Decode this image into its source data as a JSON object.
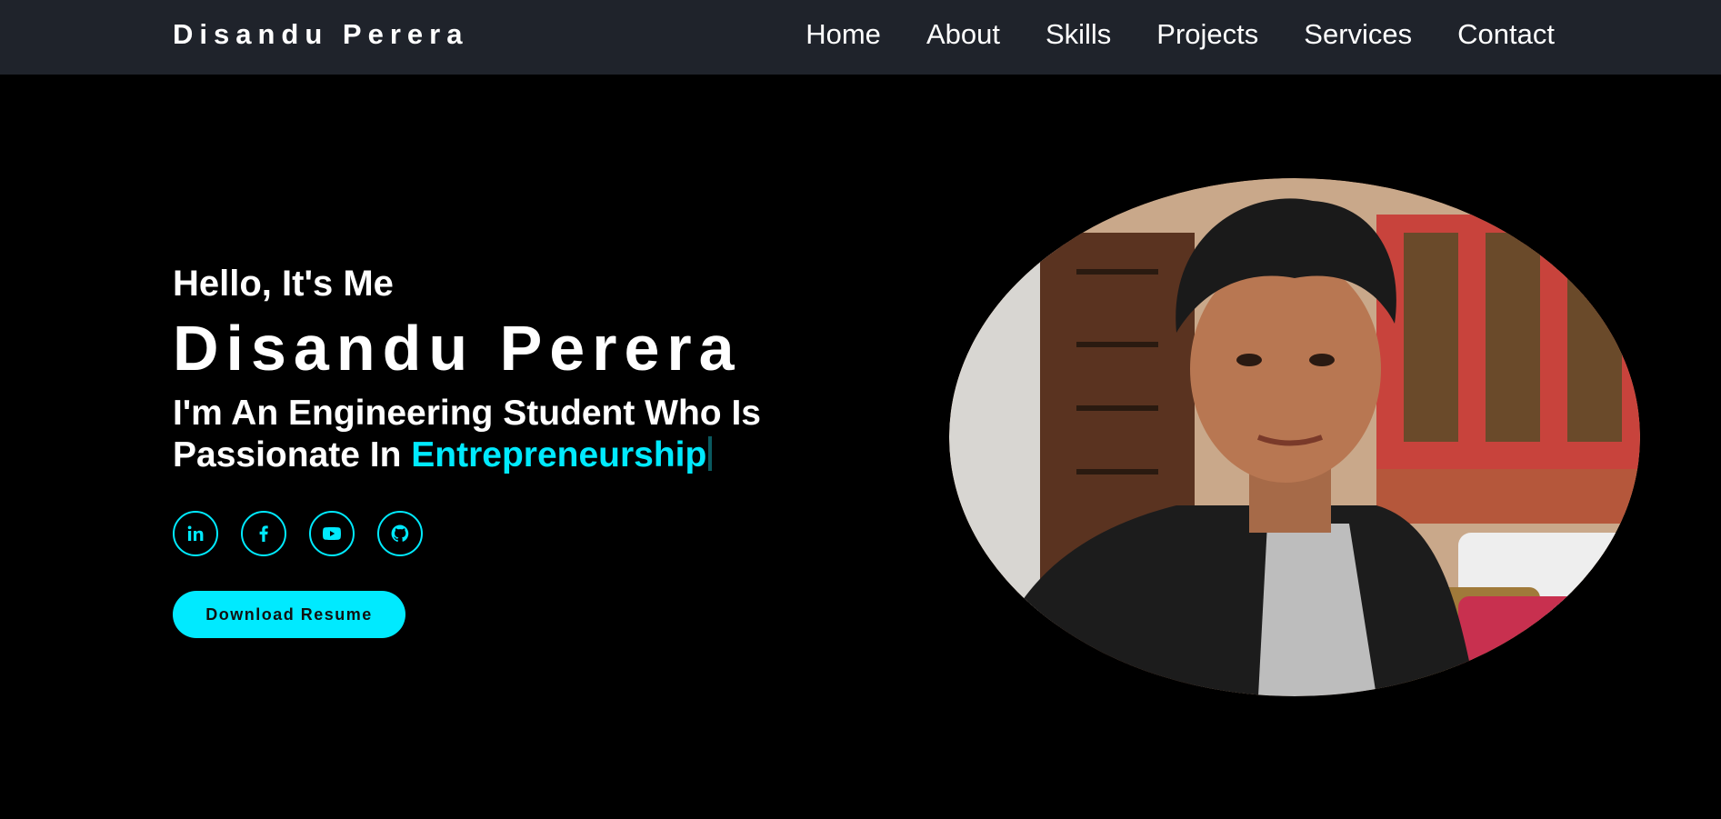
{
  "nav": {
    "brand": "Disandu Perera",
    "links": [
      "Home",
      "About",
      "Skills",
      "Projects",
      "Services",
      "Contact"
    ]
  },
  "hero": {
    "greeting": "Hello, It's Me",
    "name": "Disandu Perera",
    "tagline_prefix": "I'm An Engineering Student Who Is Passionate In ",
    "tagline_highlight": "Entrepreneurship",
    "resume_label": "Download Resume"
  },
  "socials": [
    {
      "name": "linkedin-icon",
      "glyph": "in"
    },
    {
      "name": "facebook-icon",
      "glyph": "f"
    },
    {
      "name": "youtube-icon",
      "glyph": "yt"
    },
    {
      "name": "github-icon",
      "glyph": "gh"
    }
  ],
  "colors": {
    "accent": "#00eaff",
    "navbar_bg": "#1f232b",
    "page_bg": "#000000"
  }
}
